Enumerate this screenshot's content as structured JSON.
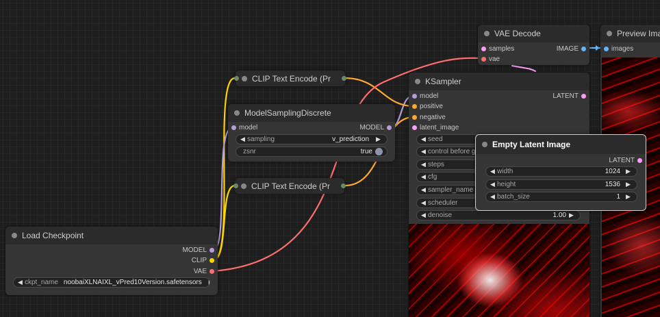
{
  "colors": {
    "model": "#b39ddb",
    "clip": "#ffd500",
    "vae": "#ff6e6e",
    "conditioning": "#ffa931",
    "latent": "#ff9cf9",
    "image": "#64b5f6"
  },
  "nodes": {
    "vae_decode": {
      "title": "VAE Decode",
      "inputs": [
        "samples",
        "vae"
      ],
      "output": "IMAGE"
    },
    "preview_image": {
      "title": "Preview Image",
      "input": "images"
    },
    "ksampler": {
      "title": "KSampler",
      "inputs": [
        "model",
        "positive",
        "negative",
        "latent_image"
      ],
      "output": "LATENT",
      "widgets": [
        "seed",
        "control before gen",
        "steps",
        "cfg",
        "sampler_name",
        "scheduler"
      ],
      "denoise_label": "denoise",
      "denoise_value": "1.00"
    },
    "clip_text_encode_1": {
      "title": "CLIP Text Encode (Pr"
    },
    "clip_text_encode_2": {
      "title": "CLIP Text Encode (Pr"
    },
    "model_sampling": {
      "title": "ModelSamplingDiscrete",
      "input": "model",
      "output": "MODEL",
      "sampling_label": "sampling",
      "sampling_value": "v_prediction",
      "zsnr_label": "zsnr",
      "zsnr_value": "true"
    },
    "load_checkpoint": {
      "title": "Load Checkpoint",
      "outputs": [
        "MODEL",
        "CLIP",
        "VAE"
      ],
      "ckpt_label": "ckpt_name",
      "ckpt_value": "noobaiXLNAIXL_vPred10Version.safetensors"
    },
    "empty_latent": {
      "title": "Empty Latent Image",
      "output": "LATENT",
      "width_label": "width",
      "width_value": "1024",
      "height_label": "height",
      "height_value": "1536",
      "batch_label": "batch_size",
      "batch_value": "1"
    }
  }
}
